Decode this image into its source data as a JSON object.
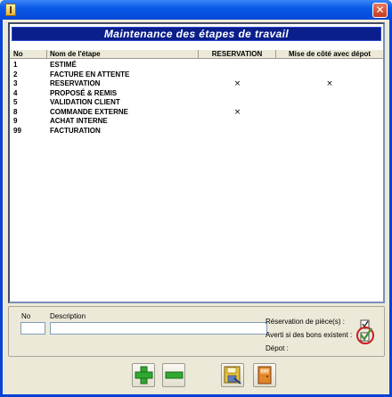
{
  "window": {
    "title": ""
  },
  "heading": "Maintenance des étapes de travail",
  "columns": {
    "no": "No",
    "name": "Nom de l'étape",
    "reservation": "RESERVATION",
    "mise": "Mise de côté avec dépot"
  },
  "rows": [
    {
      "no": "1",
      "name": "ESTIMÉ",
      "reservation": "",
      "mise": ""
    },
    {
      "no": "2",
      "name": "FACTURE EN ATTENTE",
      "reservation": "",
      "mise": ""
    },
    {
      "no": "3",
      "name": "RESERVATION",
      "reservation": "×",
      "mise": "×"
    },
    {
      "no": "4",
      "name": "PROPOSÉ & REMIS",
      "reservation": "",
      "mise": ""
    },
    {
      "no": "5",
      "name": "VALIDATION CLIENT",
      "reservation": "",
      "mise": ""
    },
    {
      "no": "8",
      "name": "COMMANDE EXTERNE",
      "reservation": "×",
      "mise": ""
    },
    {
      "no": "9",
      "name": "ACHAT INTERNE",
      "reservation": "",
      "mise": ""
    },
    {
      "no": "99",
      "name": "FACTURATION",
      "reservation": "",
      "mise": ""
    }
  ],
  "form": {
    "no_label": "No",
    "no_value": "",
    "description_label": "Description",
    "description_value": "",
    "reservation_label": "Réservation de pièce(s) :",
    "averti_label": "Averti si des bons existent :",
    "depot_label": "Dépot :"
  },
  "toolbar": {
    "add_icon": "plus-icon",
    "remove_icon": "minus-icon",
    "save_icon": "save-icon",
    "exit_label": "EXIT"
  },
  "colors": {
    "heading_bg": "#0A1E8C",
    "plus": "#2FA82F",
    "minus": "#2FA82F"
  }
}
